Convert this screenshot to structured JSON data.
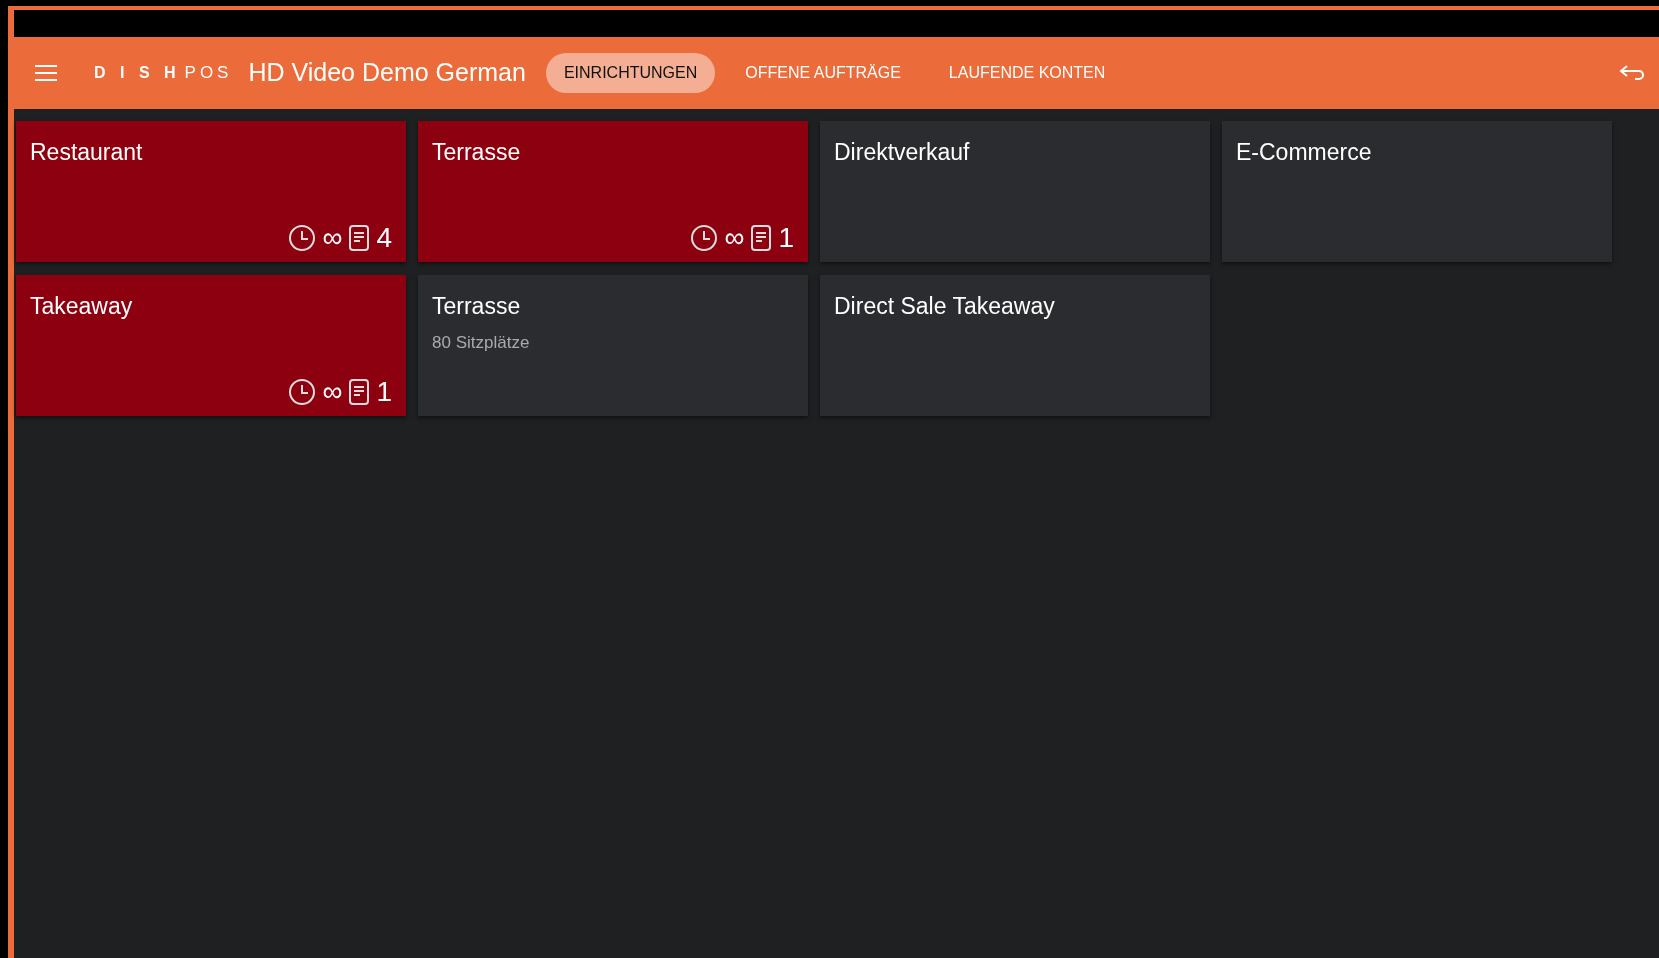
{
  "header": {
    "brand_mark": "D I S H",
    "brand_suffix": "POS",
    "title": "HD Video Demo German"
  },
  "tabs": [
    {
      "label": "EINRICHTUNGEN",
      "selected": true
    },
    {
      "label": "OFFENE AUFTRÄGE",
      "selected": false
    },
    {
      "label": "LAUFENDE KONTEN",
      "selected": false
    }
  ],
  "areas": [
    {
      "name": "Restaurant",
      "active": true,
      "duration": "∞",
      "count": "4"
    },
    {
      "name": "Terrasse",
      "active": true,
      "duration": "∞",
      "count": "1"
    },
    {
      "name": "Direktverkauf",
      "active": false
    },
    {
      "name": "E-Commerce",
      "active": false
    },
    {
      "name": "Takeaway",
      "active": true,
      "duration": "∞",
      "count": "1"
    },
    {
      "name": "Terrasse",
      "active": false,
      "subtitle": "80 Sitzplätze"
    },
    {
      "name": "Direct Sale Takeaway",
      "active": false
    }
  ]
}
